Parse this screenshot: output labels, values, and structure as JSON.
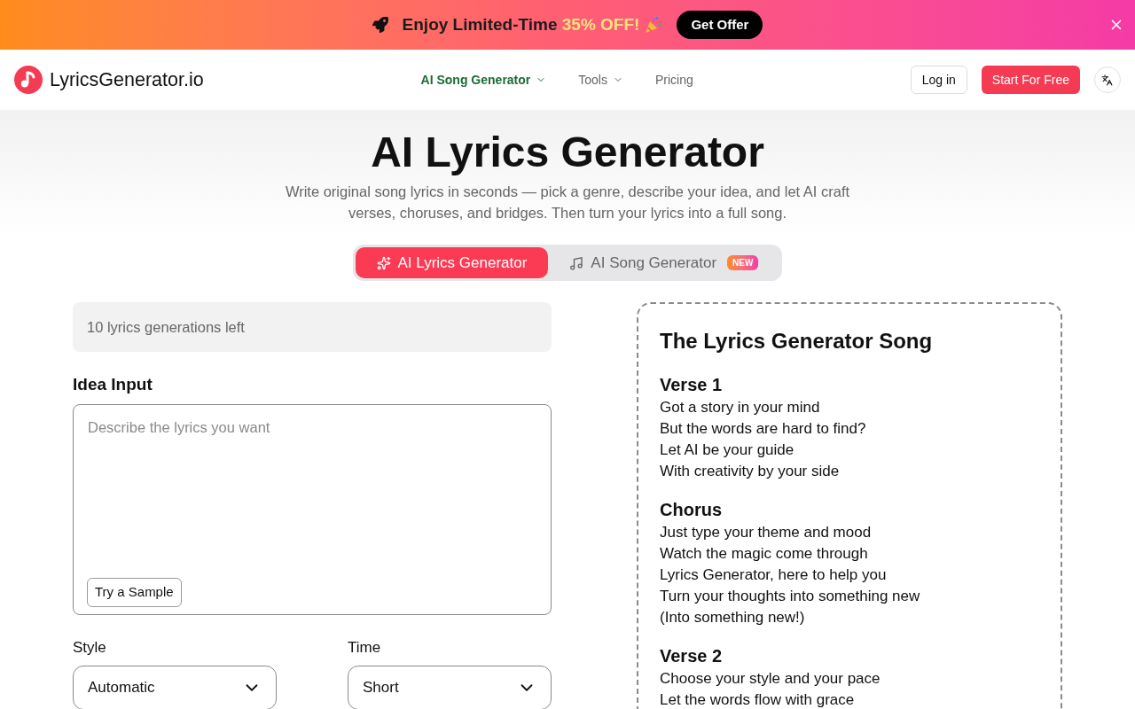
{
  "promo_banner": {
    "text": "Enjoy Limited-Time",
    "highlight": "35% OFF!",
    "button": "Get Offer"
  },
  "header": {
    "logo_text": "LyricsGenerator.io",
    "nav": [
      {
        "label": "AI Song Generator",
        "selected": true,
        "dropdown": true
      },
      {
        "label": "Tools",
        "selected": false,
        "dropdown": true
      },
      {
        "label": "Pricing",
        "selected": false,
        "dropdown": false
      }
    ],
    "login": "Log in",
    "cta": "Start For Free"
  },
  "hero": {
    "title": "AI Lyrics Generator",
    "subtitle": "Write original song lyrics in seconds — pick a genre, describe your idea, and let AI craft verses, choruses, and bridges. Then turn your lyrics into a full song."
  },
  "mode_tabs": [
    {
      "label": "AI Lyrics Generator",
      "selected": true
    },
    {
      "label": "AI Song Generator",
      "selected": false,
      "badge": "NEW"
    }
  ],
  "generator": {
    "credits": "10 lyrics generations left",
    "idea_label": "Idea Input",
    "idea_placeholder": "Describe the lyrics you want",
    "sample_button": "Try a Sample",
    "selects": [
      {
        "label": "Style",
        "value": "Automatic"
      },
      {
        "label": "Time",
        "value": "Short"
      }
    ]
  },
  "preview": {
    "title": "The Lyrics Generator Song",
    "sections": [
      {
        "heading": "Verse 1",
        "lines": [
          "Got a story in your mind",
          "But the words are hard to find?",
          "Let AI be your guide",
          "With creativity by your side"
        ]
      },
      {
        "heading": "Chorus",
        "lines": [
          "Just type your theme and mood",
          "Watch the magic come through",
          "Lyrics Generator, here to help you",
          "Turn your thoughts into something new",
          "(Into something new!)"
        ]
      },
      {
        "heading": "Verse 2",
        "lines": [
          "Choose your style and your pace",
          "Let the words flow with grace"
        ]
      }
    ]
  }
}
